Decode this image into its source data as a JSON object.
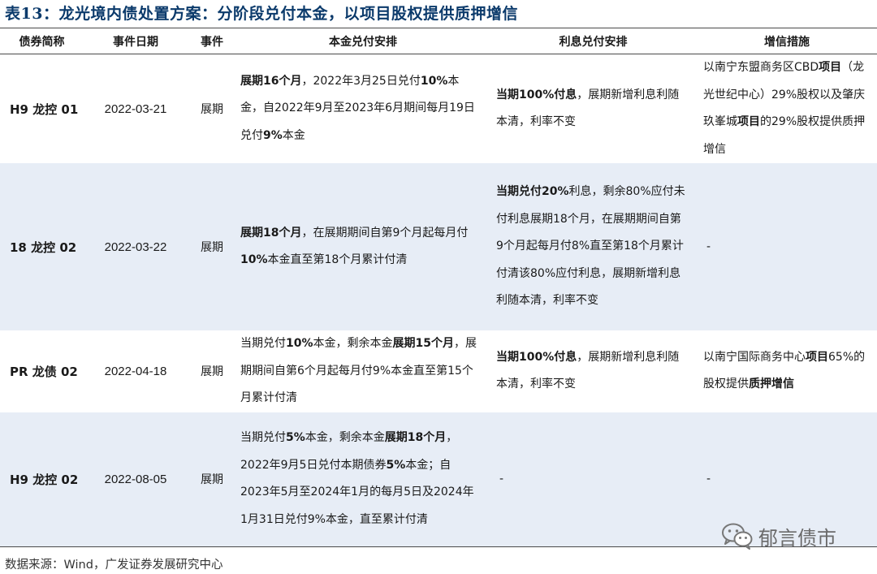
{
  "title": "表13：龙光境内债处置方案：分阶段兑付本金，以项目股权提供质押增信",
  "headers": [
    "债券简称",
    "事件日期",
    "事件",
    "本金兑付安排",
    "利息兑付安排",
    "增信措施"
  ],
  "rows": [
    {
      "code": "H9 龙控 01",
      "date": "2022-03-21",
      "event": "展期",
      "principal": [
        {
          "t": "展期16个月",
          "b": true
        },
        {
          "t": "，2022年3月25日兑付",
          "b": false
        },
        {
          "t": "10%",
          "b": true
        },
        {
          "t": "本金，自2022年9月至2023年6月期间每月19日兑付",
          "b": false
        },
        {
          "t": "9%",
          "b": true
        },
        {
          "t": "本金",
          "b": false
        }
      ],
      "interest": [
        {
          "t": "当期100%付息",
          "b": true
        },
        {
          "t": "，展期新增利息利随本清，利率不变",
          "b": false
        }
      ],
      "credit": [
        {
          "t": "以南宁东盟商务区CBD",
          "b": false
        },
        {
          "t": "项目",
          "b": true
        },
        {
          "t": "（龙光世纪中心）29%股权以及肇庆玖峯城",
          "b": false
        },
        {
          "t": "项目",
          "b": true
        },
        {
          "t": "的29%股权提供质押增信",
          "b": false
        }
      ]
    },
    {
      "code": "18 龙控 02",
      "date": "2022-03-22",
      "event": "展期",
      "principal": [
        {
          "t": "展期18个月",
          "b": true
        },
        {
          "t": "，在展期期间自第9个月起每月付",
          "b": false
        },
        {
          "t": "10%",
          "b": true
        },
        {
          "t": "本金直至第18个月累计付清",
          "b": false
        }
      ],
      "interest": [
        {
          "t": "当期兑付20%",
          "b": true
        },
        {
          "t": "利息，剩余80%应付未付利息展期18个月，在展期期间自第9个月起每月付8%直至第18个月累计付清该80%应付利息，展期新增利息利随本清，利率不变",
          "b": false
        }
      ],
      "credit": [
        {
          "t": "-",
          "b": false
        }
      ]
    },
    {
      "code": "PR 龙债 02",
      "date": "2022-04-18",
      "event": "展期",
      "principal": [
        {
          "t": "当期兑付",
          "b": false
        },
        {
          "t": "10%",
          "b": true
        },
        {
          "t": "本金，剩余本金",
          "b": false
        },
        {
          "t": "展期15个月",
          "b": true
        },
        {
          "t": "，展期期间自第6个月起每月付9%本金直至第15个月累计付清",
          "b": false
        }
      ],
      "interest": [
        {
          "t": "当期100%付息",
          "b": true
        },
        {
          "t": "，展期新增利息利随本清，利率不变",
          "b": false
        }
      ],
      "credit": [
        {
          "t": "以南宁国际商务中心",
          "b": false
        },
        {
          "t": "项目",
          "b": true
        },
        {
          "t": "65%的股权提供",
          "b": false
        },
        {
          "t": "质押增信",
          "b": true
        }
      ]
    },
    {
      "code": "H9 龙控 02",
      "date": "2022-08-05",
      "event": "展期",
      "principal": [
        {
          "t": "当期兑付",
          "b": false
        },
        {
          "t": "5%",
          "b": true
        },
        {
          "t": "本金，剩余本金",
          "b": false
        },
        {
          "t": "展期18个月",
          "b": true
        },
        {
          "t": "，2022年9月5日兑付本期债券",
          "b": false
        },
        {
          "t": "5%",
          "b": true
        },
        {
          "t": "本金；自2023年5月至2024年1月的每月5日及2024年1月31日兑付9%本金，直至累计付清",
          "b": false
        }
      ],
      "interest": [
        {
          "t": "-",
          "b": false
        }
      ],
      "credit": [
        {
          "t": "-",
          "b": false
        }
      ]
    }
  ],
  "source": "数据来源：Wind，广发证券发展研究中心",
  "watermark": "郁言债市",
  "colors": {
    "title": "#0b3a6b",
    "shaded_row": "#e7edf6",
    "rule": "#4a4a4a"
  },
  "icons": {
    "watermark": "wechat-logo-icon"
  }
}
